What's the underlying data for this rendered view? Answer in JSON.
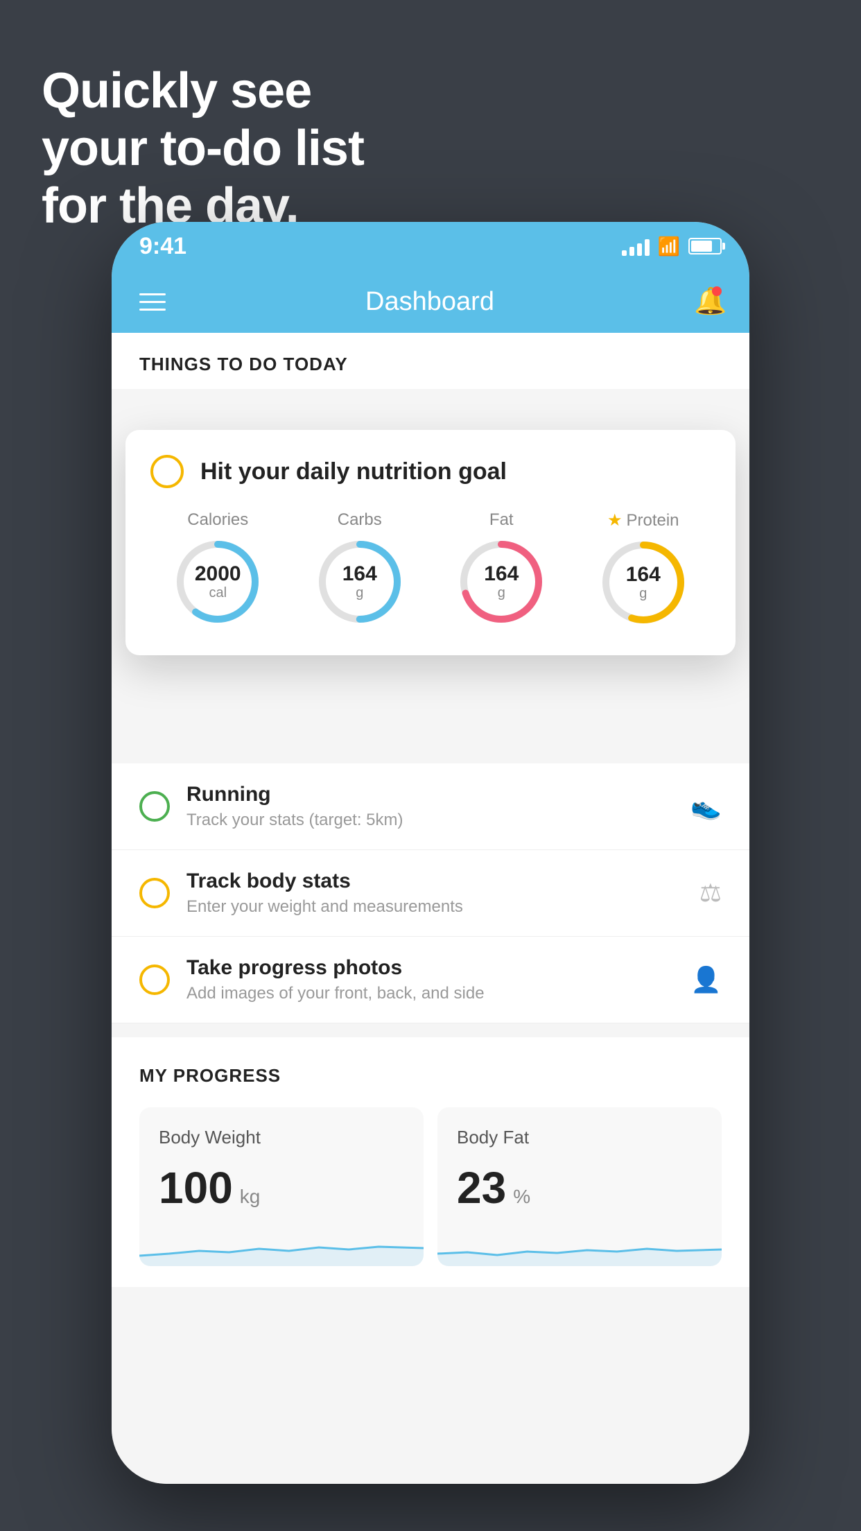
{
  "hero": {
    "line1": "Quickly see",
    "line2": "your to-do list",
    "line3": "for the day."
  },
  "statusBar": {
    "time": "9:41"
  },
  "navBar": {
    "title": "Dashboard"
  },
  "thingsToDo": {
    "header": "THINGS TO DO TODAY"
  },
  "nutritionCard": {
    "title": "Hit your daily nutrition goal",
    "stats": [
      {
        "label": "Calories",
        "value": "2000",
        "unit": "cal",
        "color": "#5bbfe8",
        "progress": 60
      },
      {
        "label": "Carbs",
        "value": "164",
        "unit": "g",
        "color": "#5bbfe8",
        "progress": 50
      },
      {
        "label": "Fat",
        "value": "164",
        "unit": "g",
        "color": "#f06080",
        "progress": 70
      },
      {
        "label": "Protein",
        "value": "164",
        "unit": "g",
        "color": "#f5b700",
        "progress": 55,
        "star": true
      }
    ]
  },
  "tasks": [
    {
      "name": "Running",
      "desc": "Track your stats (target: 5km)",
      "circleColor": "green",
      "icon": "👟"
    },
    {
      "name": "Track body stats",
      "desc": "Enter your weight and measurements",
      "circleColor": "yellow",
      "icon": "⚖"
    },
    {
      "name": "Take progress photos",
      "desc": "Add images of your front, back, and side",
      "circleColor": "yellow",
      "icon": "👤"
    }
  ],
  "myProgress": {
    "header": "MY PROGRESS",
    "cards": [
      {
        "title": "Body Weight",
        "value": "100",
        "unit": "kg"
      },
      {
        "title": "Body Fat",
        "value": "23",
        "unit": "%"
      }
    ]
  }
}
